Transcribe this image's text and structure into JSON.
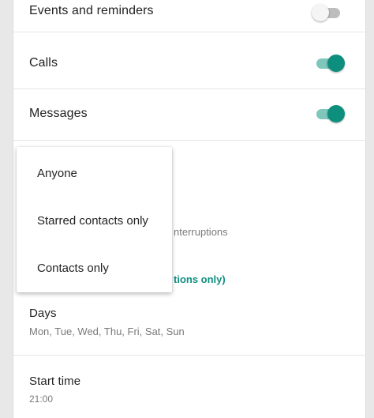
{
  "settings": {
    "events_reminders": {
      "label": "Events and reminders",
      "enabled": false
    },
    "calls": {
      "label": "Calls",
      "enabled": true
    },
    "messages": {
      "label": "Messages",
      "enabled": true
    },
    "partial_interruptions_text": "nterruptions",
    "partial_accent_text": "tions only)",
    "days": {
      "label": "Days",
      "value": "Mon, Tue, Wed, Thu, Fri, Sat, Sun"
    },
    "start_time": {
      "label": "Start time",
      "value": "21:00"
    }
  },
  "dropdown": {
    "options": [
      "Anyone",
      "Starred contacts only",
      "Contacts only"
    ]
  },
  "colors": {
    "accent": "#0e8f7e",
    "accent_track": "#7fc6bb",
    "toggle_off_track": "#bdbdbd"
  }
}
